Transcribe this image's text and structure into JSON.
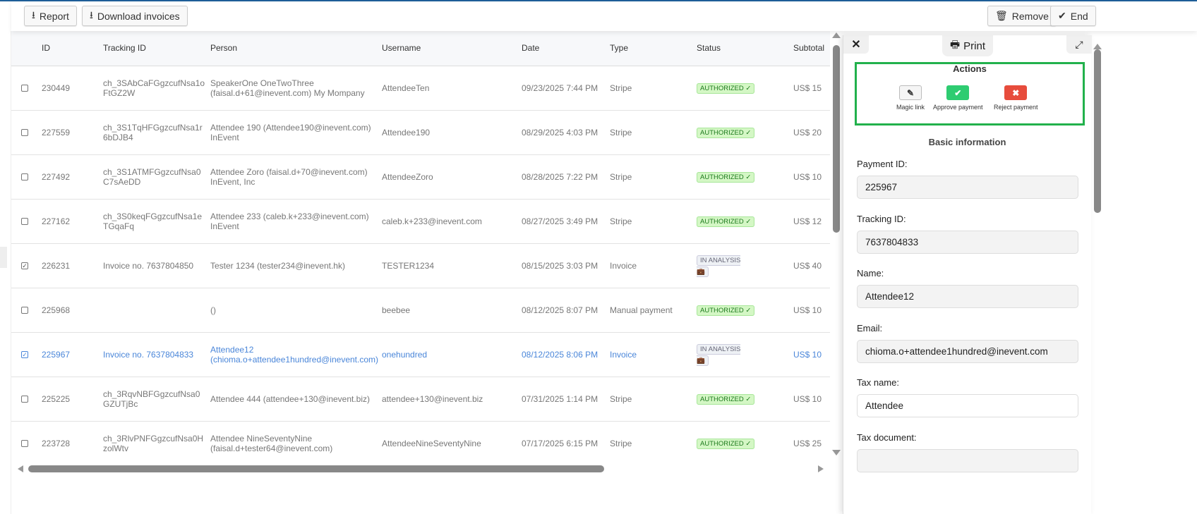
{
  "toolbar": {
    "report": "Report",
    "download": "Download invoices",
    "remove": "Remove",
    "end": "End"
  },
  "columns": [
    "ID",
    "Tracking ID",
    "Person",
    "Username",
    "Date",
    "Type",
    "Status",
    "Subtotal"
  ],
  "rows": [
    {
      "checked": false,
      "id": "230449",
      "tracking": "ch_3SAbCaFGgzcufNsa1oFtGZ2W",
      "person": "SpeakerOne OneTwoThree (faisal.d+61@inevent.com) My Mompany",
      "username": "AttendeeTen",
      "date": "09/23/2025 7:44 PM",
      "type": "Stripe",
      "status": "AUTHORIZED ✓",
      "subtotal": "US$ 15"
    },
    {
      "checked": false,
      "id": "227559",
      "tracking": "ch_3S1TqHFGgzcufNsa1r6bDJB4",
      "person": "Attendee 190 (Attendee190@inevent.com) InEvent",
      "username": "Attendee190",
      "date": "08/29/2025 4:03 PM",
      "type": "Stripe",
      "status": "AUTHORIZED ✓",
      "subtotal": "US$ 20"
    },
    {
      "checked": false,
      "id": "227492",
      "tracking": "ch_3S1ATMFGgzcufNsa0C7sAeDD",
      "person": "Attendee Zoro (faisal.d+70@inevent.com) InEvent, Inc",
      "username": "AttendeeZoro",
      "date": "08/28/2025 7:22 PM",
      "type": "Stripe",
      "status": "AUTHORIZED ✓",
      "subtotal": "US$ 10"
    },
    {
      "checked": false,
      "id": "227162",
      "tracking": "ch_3S0keqFGgzcufNsa1eTGqaFq",
      "person": "Attendee 233 (caleb.k+233@inevent.com) InEvent",
      "username": "caleb.k+233@inevent.com",
      "date": "08/27/2025 3:49 PM",
      "type": "Stripe",
      "status": "AUTHORIZED ✓",
      "subtotal": "US$ 12"
    },
    {
      "checked": true,
      "id": "226231",
      "tracking": "Invoice no. 7637804850",
      "person": "Tester 1234 (tester234@inevent.hk)",
      "username": "TESTER1234",
      "date": "08/15/2025 3:03 PM",
      "type": "Invoice",
      "status": "IN ANALYSIS",
      "subtotal": "US$ 40"
    },
    {
      "checked": false,
      "id": "225968",
      "tracking": "",
      "person": "()",
      "username": "beebee",
      "date": "08/12/2025 8:07 PM",
      "type": "Manual payment",
      "status": "AUTHORIZED ✓",
      "subtotal": "US$ 10"
    },
    {
      "checked": true,
      "selected": true,
      "id": "225967",
      "tracking": "Invoice no. 7637804833",
      "person": "Attendee12 (chioma.o+attendee1hundred@inevent.com)",
      "username": "onehundred",
      "date": "08/12/2025 8:06 PM",
      "type": "Invoice",
      "status": "IN ANALYSIS",
      "subtotal": "US$ 10"
    },
    {
      "checked": false,
      "id": "225225",
      "tracking": "ch_3RqvNBFGgzcufNsa0GZUTjBc",
      "person": "Attendee 444 (attendee+130@inevent.biz)",
      "username": "attendee+130@inevent.biz",
      "date": "07/31/2025 1:14 PM",
      "type": "Stripe",
      "status": "AUTHORIZED ✓",
      "subtotal": "US$ 10"
    },
    {
      "checked": false,
      "id": "223728",
      "tracking": "ch_3RlvPNFGgzcufNsa0HzolWtv",
      "person": "Attendee NineSeventyNine (faisal.d+tester64@inevent.com)",
      "username": "AttendeeNineSeventyNine",
      "date": "07/17/2025 6:15 PM",
      "type": "Stripe",
      "status": "AUTHORIZED ✓",
      "subtotal": "US$ 25"
    }
  ],
  "panel": {
    "print": "Print",
    "actions_title": "Actions",
    "magic": "Magic link",
    "approve": "Approve payment",
    "reject": "Reject payment",
    "basic": "Basic information",
    "fields": [
      {
        "label": "Payment ID:",
        "value": "225967"
      },
      {
        "label": "Tracking ID:",
        "value": "7637804833"
      },
      {
        "label": "Name:",
        "value": "Attendee12"
      },
      {
        "label": "Email:",
        "value": "chioma.o+attendee1hundred@inevent.com"
      },
      {
        "label": "Tax name:",
        "value": "Attendee"
      },
      {
        "label": "Tax document:",
        "value": ""
      }
    ]
  },
  "colors": {
    "approve": "#2ecc71",
    "reject": "#e74c3c",
    "highlight": "#22b14c",
    "selected": "#4a86d9"
  }
}
